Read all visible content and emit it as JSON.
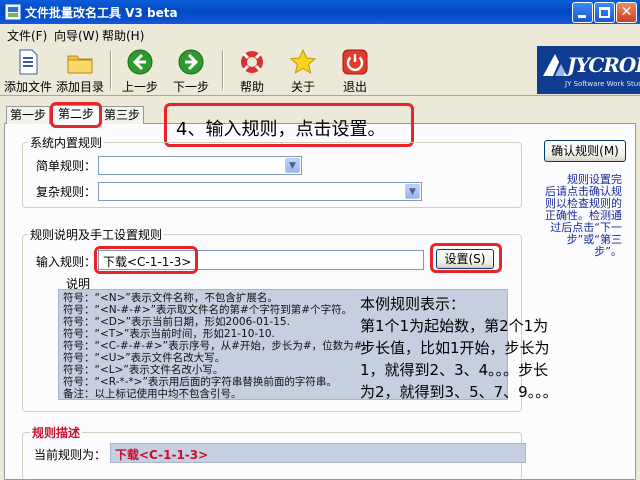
{
  "window": {
    "title": "文件批量改名工具 V3 beta",
    "close_glyph": "✕"
  },
  "menu": [
    {
      "label": "文件(F)"
    },
    {
      "label": "向导(W)"
    },
    {
      "label": "帮助(H)"
    }
  ],
  "toolbar": {
    "add_file": "添加文件",
    "add_dir": "添加目录",
    "prev": "上一步",
    "next": "下一步",
    "help": "帮助",
    "about": "关于",
    "exit": "退出"
  },
  "logo": {
    "brand": "JYCROP",
    "studio": "JY Software Work Studio"
  },
  "tabs": [
    "第一步",
    "第二步",
    "第三步"
  ],
  "callout": "4、输入规则，点击设置。",
  "builtin_rules": {
    "legend": "系统内置规则",
    "simple_label": "简单规则：",
    "complex_label": "复杂规则：",
    "simple_value": "",
    "complex_value": ""
  },
  "confirm_button": "确认规则(M)",
  "side_note": [
    "规则设置完",
    "后请点击确认规",
    "则以检查规则的",
    "正确性。检测通",
    "过后点击“下一",
    "步”或“第三",
    "步”。"
  ],
  "manual_rules": {
    "legend": "规则说明及手工设置规则",
    "input_label": "输入规则：",
    "input_value": "下载<C-1-1-3>",
    "set_button": "设置(S)",
    "desc_label": "说明"
  },
  "descriptions": [
    "符号：“<N>”表示文件名称，不包含扩展名。",
    "符号：“<N-#-#>”表示取文件名的第#个字符到第#个字符。",
    "符号：“<D>”表示当前日期，形如2006-01-15.",
    "符号：“<T>”表示当前时间，形如21-10-10.",
    "符号：“<C-#-#-#>”表示序号，从#开始，步长为#，位数为#。",
    "符号：“<U>”表示文件名改大写。",
    "符号：“<L>”表示文件名改小写。",
    "符号：“<R-*-*>”表示用后面的字符串替换前面的字符串。",
    "备注：以上标记使用中均不包含引号。"
  ],
  "example": [
    "本例规则表示：",
    "第1个1为起始数，第2个1为",
    "步长值，比如1开始，步长为",
    "1，就得到2、3、4。。。步长",
    "为2，就得到3、5、7、9。。。"
  ],
  "rule_desc": {
    "legend": "规则描述",
    "current_label": "当前规则为：",
    "current_value": "下载<C-1-1-3>"
  }
}
